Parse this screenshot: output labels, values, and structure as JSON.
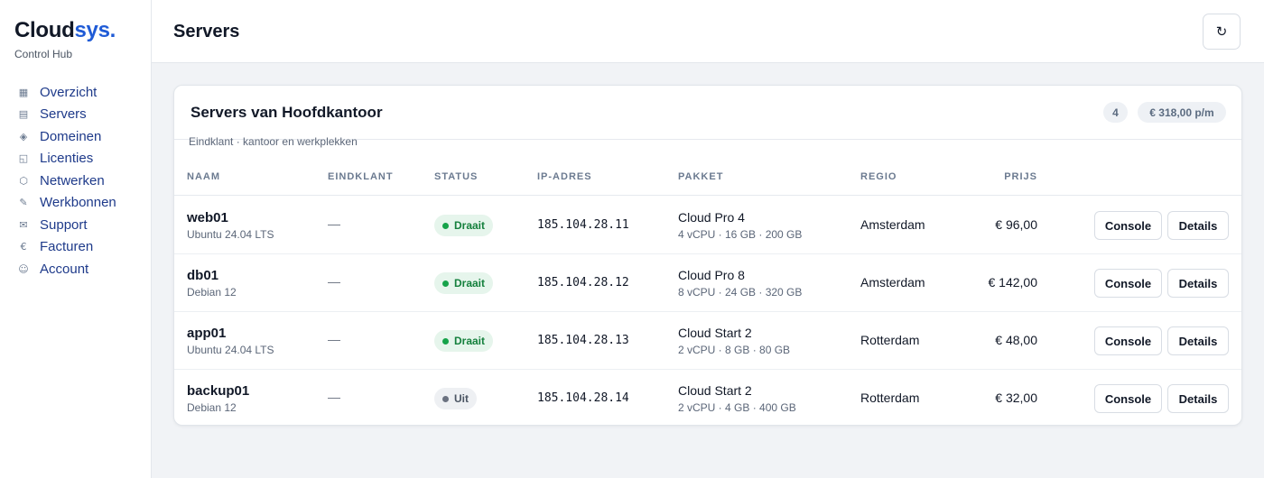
{
  "brand": {
    "name_main": "Cloud",
    "name_accent": "sys.",
    "subtitle": "Control Hub"
  },
  "sidebar": {
    "items": [
      {
        "icon": "grid-icon",
        "glyph": "▦",
        "label": "Overzicht"
      },
      {
        "icon": "server-icon",
        "glyph": "▤",
        "label": "Servers"
      },
      {
        "icon": "globe-icon",
        "glyph": "◈",
        "label": "Domeinen"
      },
      {
        "icon": "license-icon",
        "glyph": "◱",
        "label": "Licenties"
      },
      {
        "icon": "network-icon",
        "glyph": "⬡",
        "label": "Netwerken"
      },
      {
        "icon": "ticket-icon",
        "glyph": "✎",
        "label": "Werkbonnen"
      },
      {
        "icon": "mail-icon",
        "glyph": "✉",
        "label": "Support"
      },
      {
        "icon": "euro-icon",
        "glyph": "€",
        "label": "Facturen"
      },
      {
        "icon": "user-icon",
        "glyph": "☺",
        "label": "Account"
      }
    ]
  },
  "header": {
    "title": "Servers",
    "refresh_icon": "↻"
  },
  "card": {
    "title": "Servers van Hoofdkantoor",
    "subtitle": "Eindklant · kantoor en werkplekken",
    "count": "4",
    "total": "€ 318,00 p/m"
  },
  "table": {
    "columns": {
      "naam": "NAAM",
      "eindklant": "EINDKLANT",
      "status": "STATUS",
      "ip": "IP-ADRES",
      "pakket": "PAKKET",
      "regio": "REGIO",
      "prijs": "PRIJS"
    },
    "rows": [
      {
        "name": "web01",
        "os": "Ubuntu 24.04 LTS",
        "customer": "—",
        "status": "Draait",
        "status_kind": "on",
        "ip": "185.104.28.11",
        "package": "Cloud Pro 4",
        "specs": "4 vCPU · 16 GB · 200 GB",
        "region": "Amsterdam",
        "price": "€ 96,00",
        "console": "Console",
        "details": "Details"
      },
      {
        "name": "db01",
        "os": "Debian 12",
        "customer": "—",
        "status": "Draait",
        "status_kind": "on",
        "ip": "185.104.28.12",
        "package": "Cloud Pro 8",
        "specs": "8 vCPU · 24 GB · 320 GB",
        "region": "Amsterdam",
        "price": "€ 142,00",
        "console": "Console",
        "details": "Details"
      },
      {
        "name": "app01",
        "os": "Ubuntu 24.04 LTS",
        "customer": "—",
        "status": "Draait",
        "status_kind": "on",
        "ip": "185.104.28.13",
        "package": "Cloud Start 2",
        "specs": "2 vCPU · 8 GB · 80 GB",
        "region": "Rotterdam",
        "price": "€ 48,00",
        "console": "Console",
        "details": "Details"
      },
      {
        "name": "backup01",
        "os": "Debian 12",
        "customer": "—",
        "status": "Uit",
        "status_kind": "off",
        "ip": "185.104.28.14",
        "package": "Cloud Start 2",
        "specs": "2 vCPU · 4 GB · 400 GB",
        "region": "Rotterdam",
        "price": "€ 32,00",
        "console": "Console",
        "details": "Details"
      }
    ]
  },
  "colors": {
    "accent": "#1f5bd6",
    "running": "#15803d",
    "off": "#4b5563"
  }
}
